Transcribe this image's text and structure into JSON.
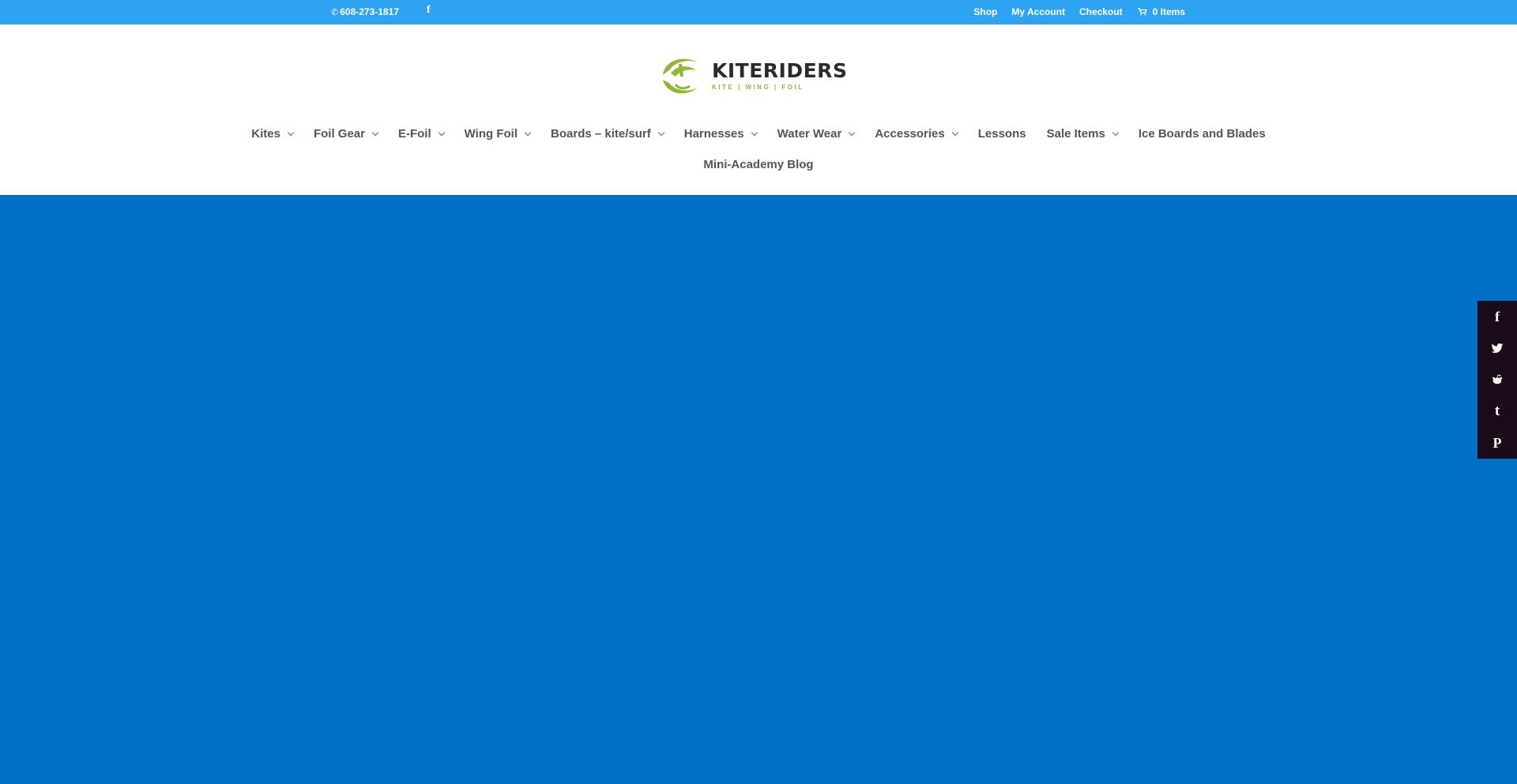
{
  "topbar": {
    "phone": "608-273-1817",
    "phone_icon": "phone-icon",
    "facebook_icon": "facebook-icon",
    "links": [
      "Shop",
      "My Account",
      "Checkout"
    ],
    "cart_label": "0 Items",
    "cart_icon": "cart-icon"
  },
  "logo": {
    "title": "KITERIDERS",
    "tagline": "KITE | WING | FOIL",
    "brand_green": "#8fb73a"
  },
  "nav": {
    "row1": [
      {
        "label": "Kites",
        "has_dropdown": true
      },
      {
        "label": "Foil Gear",
        "has_dropdown": true
      },
      {
        "label": "E-Foil",
        "has_dropdown": true
      },
      {
        "label": "Wing Foil",
        "has_dropdown": true
      },
      {
        "label": "Boards – kite/surf",
        "has_dropdown": true
      },
      {
        "label": "Harnesses",
        "has_dropdown": true
      },
      {
        "label": "Water Wear",
        "has_dropdown": true
      },
      {
        "label": "Accessories",
        "has_dropdown": true
      },
      {
        "label": "Lessons",
        "has_dropdown": false
      },
      {
        "label": "Sale Items",
        "has_dropdown": true
      },
      {
        "label": "Ice Boards and Blades",
        "has_dropdown": false
      }
    ],
    "row2": [
      {
        "label": "Mini-Academy Blog",
        "has_dropdown": false
      }
    ]
  },
  "social": [
    "facebook-icon",
    "twitter-icon",
    "reddit-icon",
    "tumblr-icon",
    "pinterest-icon"
  ],
  "colors": {
    "topbar": "#2ea3f2",
    "body": "#006fc6",
    "sidebar": "#1a0a1a"
  }
}
